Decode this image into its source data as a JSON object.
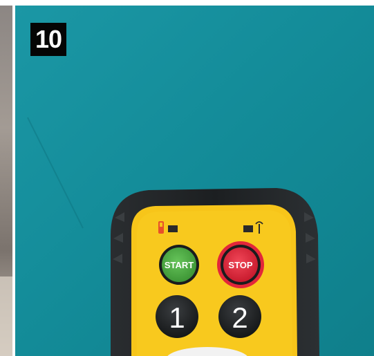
{
  "step_number": "10",
  "remote": {
    "start_label": "START",
    "stop_label": "STOP",
    "button_1_label": "1",
    "button_2_label": "2"
  },
  "colors": {
    "wall_teal": "#168f9c",
    "remote_yellow": "#f7c51a",
    "remote_body": "#1f2224",
    "start_green": "#4aa63f",
    "stop_red": "#e2263a"
  },
  "icons": [
    "battery-icon",
    "antenna-icon"
  ]
}
